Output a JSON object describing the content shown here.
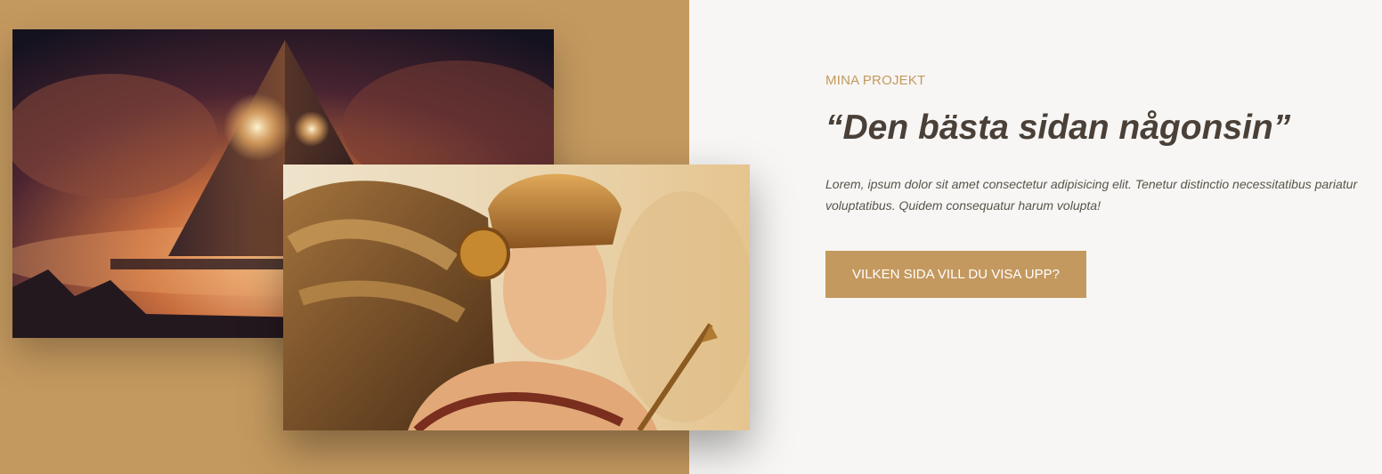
{
  "section": {
    "eyebrow": "MINA PROJEKT",
    "headline": "“Den bästa sidan någonsin”",
    "body": "Lorem, ipsum dolor sit amet consectetur adipisicing elit. Tenetur distinctio necessitatibus pariatur voluptatibus. Quidem consequatur harum volupta!",
    "cta_label": "VILKEN SIDA VILL DU VISA UPP?"
  },
  "images": [
    {
      "icon": "pyramid-artwork"
    },
    {
      "icon": "warrior-artwork"
    }
  ],
  "colors": {
    "accent": "#c4995f",
    "background": "#f7f6f4",
    "heading": "#4a4037"
  }
}
